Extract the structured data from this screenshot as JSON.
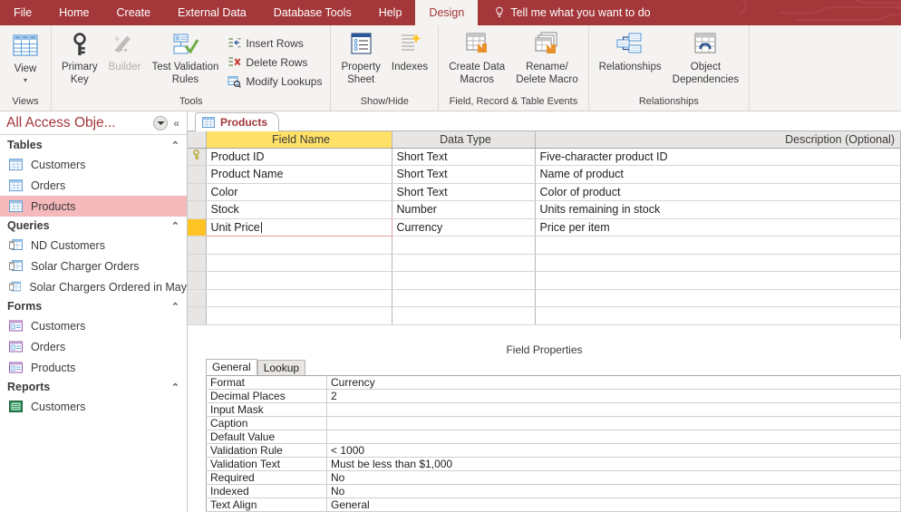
{
  "ribbon": {
    "tabs": [
      {
        "label": "File",
        "active": false
      },
      {
        "label": "Home",
        "active": false
      },
      {
        "label": "Create",
        "active": false
      },
      {
        "label": "External Data",
        "active": false
      },
      {
        "label": "Database Tools",
        "active": false
      },
      {
        "label": "Help",
        "active": false
      },
      {
        "label": "Design",
        "active": true
      }
    ],
    "tell_me": "Tell me what you want to do",
    "accent_color": "#a4373a",
    "groups": [
      {
        "label": "Views",
        "buttons": [
          {
            "label": "View",
            "icon": "table-view-icon",
            "has_caret": true,
            "disabled": false
          }
        ]
      },
      {
        "label": "Tools",
        "buttons": [
          {
            "label": "Primary\nKey",
            "icon": "key-icon",
            "has_caret": false,
            "disabled": false
          },
          {
            "label": "Builder",
            "icon": "wand-icon",
            "has_caret": false,
            "disabled": true
          },
          {
            "label": "Test Validation\nRules",
            "icon": "validation-check-icon",
            "has_caret": false,
            "disabled": false
          }
        ],
        "small_buttons": [
          {
            "label": "Insert Rows",
            "icon": "insert-rows-icon"
          },
          {
            "label": "Delete Rows",
            "icon": "delete-rows-icon"
          },
          {
            "label": "Modify Lookups",
            "icon": "modify-lookups-icon"
          }
        ]
      },
      {
        "label": "Show/Hide",
        "buttons": [
          {
            "label": "Property\nSheet",
            "icon": "property-sheet-icon",
            "has_caret": false,
            "disabled": false
          },
          {
            "label": "Indexes",
            "icon": "indexes-icon",
            "has_caret": false,
            "disabled": false
          }
        ]
      },
      {
        "label": "Field, Record & Table Events",
        "buttons": [
          {
            "label": "Create Data\nMacros",
            "icon": "create-data-macros-icon",
            "has_caret": true,
            "disabled": false
          },
          {
            "label": "Rename/\nDelete Macro",
            "icon": "rename-delete-macro-icon",
            "has_caret": false,
            "disabled": false
          }
        ]
      },
      {
        "label": "Relationships",
        "buttons": [
          {
            "label": "Relationships",
            "icon": "relationships-icon",
            "has_caret": false,
            "disabled": false
          },
          {
            "label": "Object\nDependencies",
            "icon": "object-dependencies-icon",
            "has_caret": false,
            "disabled": false
          }
        ]
      }
    ]
  },
  "nav": {
    "title": "All Access Obje...",
    "dropdown_icon": "chevron-down-circle-icon",
    "collapse_icon": "double-chevron-left-icon",
    "groups": [
      {
        "label": "Tables",
        "collapse_icon": "chevron-up-icon",
        "items": [
          {
            "label": "Customers",
            "icon": "table-icon",
            "selected": false
          },
          {
            "label": "Orders",
            "icon": "table-icon",
            "selected": false
          },
          {
            "label": "Products",
            "icon": "table-icon",
            "selected": true
          }
        ]
      },
      {
        "label": "Queries",
        "collapse_icon": "chevron-up-icon",
        "items": [
          {
            "label": "ND Customers",
            "icon": "query-icon",
            "selected": false
          },
          {
            "label": "Solar Charger Orders",
            "icon": "query-icon",
            "selected": false
          },
          {
            "label": "Solar Chargers Ordered in May",
            "icon": "query-icon",
            "selected": false
          }
        ]
      },
      {
        "label": "Forms",
        "collapse_icon": "chevron-up-icon",
        "items": [
          {
            "label": "Customers",
            "icon": "form-icon",
            "selected": false
          },
          {
            "label": "Orders",
            "icon": "form-icon",
            "selected": false
          },
          {
            "label": "Products",
            "icon": "form-icon",
            "selected": false
          }
        ]
      },
      {
        "label": "Reports",
        "collapse_icon": "chevron-up-icon",
        "items": [
          {
            "label": "Customers",
            "icon": "report-icon",
            "selected": false
          }
        ]
      }
    ]
  },
  "document": {
    "tab": {
      "label": "Products",
      "icon": "table-icon"
    },
    "grid": {
      "headers": {
        "selector": "",
        "field_name": "Field Name",
        "data_type": "Data Type",
        "description": "Description (Optional)"
      },
      "header_highlight_color": "#ffe168",
      "rows": [
        {
          "selector_icon": "key-icon",
          "field_name": "Product ID",
          "data_type": "Short Text",
          "description": "Five-character product ID",
          "editing": false,
          "active": false
        },
        {
          "selector_icon": "",
          "field_name": "Product Name",
          "data_type": "Short Text",
          "description": "Name of product",
          "editing": false,
          "active": false
        },
        {
          "selector_icon": "",
          "field_name": "Color",
          "data_type": "Short Text",
          "description": "Color of product",
          "editing": false,
          "active": false
        },
        {
          "selector_icon": "",
          "field_name": "Stock",
          "data_type": "Number",
          "description": "Units remaining in stock",
          "editing": false,
          "active": false
        },
        {
          "selector_icon": "",
          "field_name": "Unit Price",
          "data_type": "Currency",
          "description": "Price per item",
          "editing": true,
          "active": true
        }
      ],
      "empty_row_count": 5
    },
    "field_properties": {
      "banner": "Field Properties",
      "tabs": [
        {
          "label": "General",
          "active": true
        },
        {
          "label": "Lookup",
          "active": false
        }
      ],
      "rows": [
        {
          "name": "Format",
          "value": "Currency"
        },
        {
          "name": "Decimal Places",
          "value": "2"
        },
        {
          "name": "Input Mask",
          "value": ""
        },
        {
          "name": "Caption",
          "value": ""
        },
        {
          "name": "Default Value",
          "value": ""
        },
        {
          "name": "Validation Rule",
          "value": "< 1000"
        },
        {
          "name": "Validation Text",
          "value": "Must be less than $1,000"
        },
        {
          "name": "Required",
          "value": "No"
        },
        {
          "name": "Indexed",
          "value": "No"
        },
        {
          "name": "Text Align",
          "value": "General"
        }
      ]
    }
  }
}
